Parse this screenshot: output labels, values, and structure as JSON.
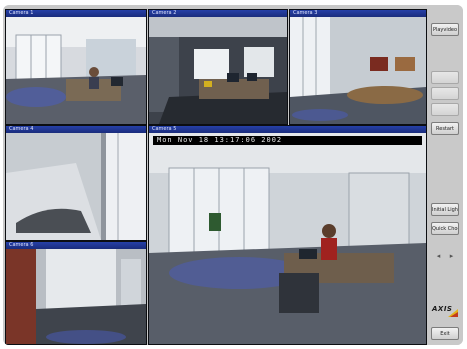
{
  "cameras": [
    {
      "title": "Camera 1",
      "view": "office-left"
    },
    {
      "title": "Camera 2",
      "view": "desk-room"
    },
    {
      "title": "Camera 3",
      "view": "conference-room"
    },
    {
      "title": "Camera 4",
      "view": "entrance-door"
    },
    {
      "title": "Camera 5",
      "view": "main-office",
      "timestamp": "Mon Nov 18 13:17:06 2002"
    },
    {
      "title": "Camera 6",
      "view": "corridor"
    }
  ],
  "sidebar": {
    "buttons": [
      {
        "label": "Playvideo",
        "enabled": true
      },
      {
        "label": "",
        "enabled": false
      },
      {
        "label": "",
        "enabled": false
      },
      {
        "label": "",
        "enabled": false
      },
      {
        "label": "Restart",
        "enabled": true
      },
      {
        "label": "Initial Light",
        "enabled": true
      },
      {
        "label": "Quick Choose",
        "enabled": true
      },
      {
        "label": "Exit",
        "enabled": true
      }
    ],
    "nav_left": "◂",
    "nav_right": "▸",
    "logo": "AXIS"
  },
  "colors": {
    "frame_bg": "#c8c8c8",
    "title_bar": "#2640a8",
    "logo_accent": "#e2b21a"
  }
}
